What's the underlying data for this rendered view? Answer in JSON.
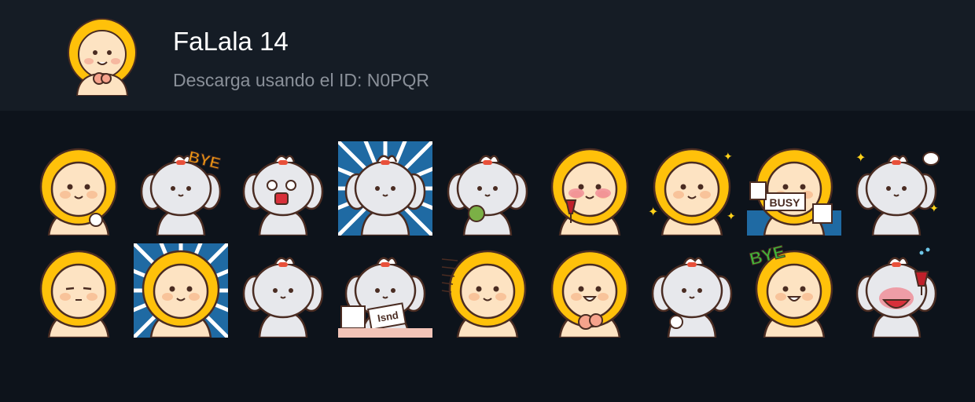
{
  "header": {
    "title": "FaLala 14",
    "subtitle": "Descarga usando el ID: N0PQR"
  },
  "colors": {
    "background": "#0d131b",
    "header_background": "#151c25",
    "mane_yellow": "#ffc10a",
    "face_peach": "#fde3c2",
    "dog_grey": "#e7e8ec",
    "outline": "#4a2c22",
    "bye_orange": "#f29a12",
    "bye_green": "#3dbb3a",
    "action_blue": "#1f6aa3"
  },
  "stickers": [
    {
      "character": "lion",
      "pose": "waving"
    },
    {
      "character": "dog",
      "pose": "bye",
      "text": "BYE"
    },
    {
      "character": "dog",
      "pose": "shocked"
    },
    {
      "character": "dog",
      "pose": "dramatic"
    },
    {
      "character": "dog",
      "pose": "eating"
    },
    {
      "character": "lion",
      "pose": "wine"
    },
    {
      "character": "lion",
      "pose": "sparkle"
    },
    {
      "character": "lion",
      "pose": "busy",
      "text": "BUSY"
    },
    {
      "character": "dog",
      "pose": "sparkle"
    },
    {
      "character": "lion",
      "pose": "sleepy"
    },
    {
      "character": "lion",
      "pose": "dramatic"
    },
    {
      "character": "dog",
      "pose": "sad"
    },
    {
      "character": "dog",
      "pose": "writing",
      "text": "Isnd"
    },
    {
      "character": "lion",
      "pose": "running"
    },
    {
      "character": "lion",
      "pose": "cheeks"
    },
    {
      "character": "dog",
      "pose": "bowing"
    },
    {
      "character": "lion",
      "pose": "bye",
      "text": "BYE"
    },
    {
      "character": "dog",
      "pose": "wine"
    }
  ]
}
